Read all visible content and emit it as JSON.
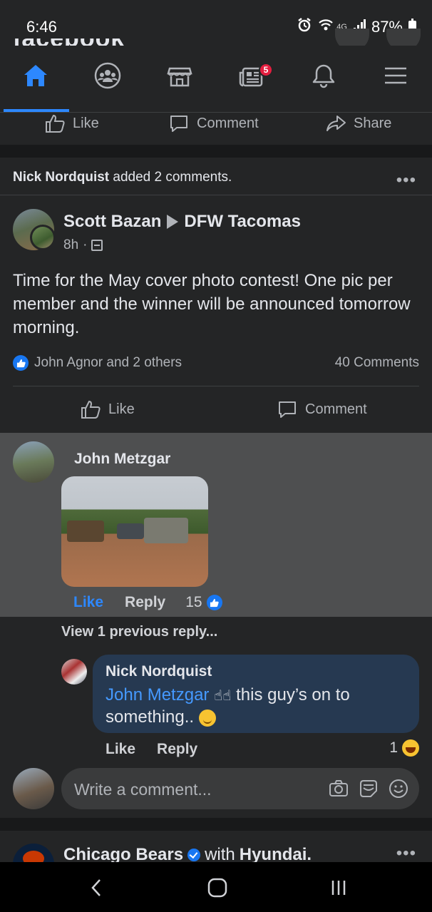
{
  "status_bar": {
    "time": "6:46",
    "network": "4G",
    "battery": "87%"
  },
  "nav": {
    "tabs": [
      {
        "name": "home",
        "active": true
      },
      {
        "name": "groups"
      },
      {
        "name": "marketplace"
      },
      {
        "name": "news",
        "badge": "5"
      },
      {
        "name": "notifications"
      },
      {
        "name": "menu"
      }
    ]
  },
  "prev_post_actions": {
    "like": "Like",
    "comment": "Comment",
    "share": "Share"
  },
  "post": {
    "activity_actor": "Nick Nordquist",
    "activity_text": " added 2 comments.",
    "author": "Scott Bazan",
    "group": "DFW Tacomas",
    "time": "8h",
    "text": "Time for the May cover photo contest!  One pic per member and the winner will be announced tomorrow morning.",
    "reactions_text": "John Agnor and 2 others",
    "comments_count": "40 Comments",
    "actions": {
      "like": "Like",
      "comment": "Comment"
    }
  },
  "comment1": {
    "author": "John Metzgar",
    "like": "Like",
    "reply": "Reply",
    "reaction_count": "15"
  },
  "view_previous": "View 1 previous reply...",
  "reply1": {
    "author": "Nick Nordquist",
    "mention": "John Metzgar",
    "text": "this guy’s on to something..",
    "like": "Like",
    "reply": "Reply",
    "reaction_count": "1"
  },
  "composer": {
    "placeholder": "Write a comment..."
  },
  "next_post": {
    "author": "Chicago Bears",
    "with_text": "with",
    "partner": "Hyundai."
  },
  "colors": {
    "accent": "#2d88ff",
    "badge": "#e41e3f",
    "bubble": "#263951",
    "highlight": "#4e4f50"
  }
}
